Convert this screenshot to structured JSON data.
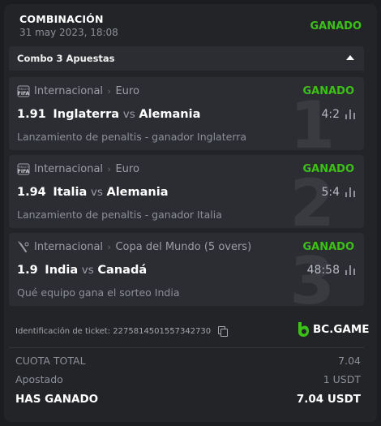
{
  "header": {
    "title": "COMBINACIÓN",
    "date": "31 may 2023, 18:08",
    "status": "GANADO"
  },
  "combo": {
    "label": "Combo 3 Apuestas"
  },
  "legs": [
    {
      "index": "1",
      "sport_icon": "efootball-penalty-icon",
      "category": "Internacional",
      "league": "Euro",
      "status": "GANADO",
      "odds": "1.91",
      "home": "Inglaterra",
      "vs": "vs",
      "away": "Alemania",
      "score": "4:2",
      "market": "Lanzamiento de penaltis - ganador Inglaterra"
    },
    {
      "index": "2",
      "sport_icon": "efootball-penalty-icon",
      "category": "Internacional",
      "league": "Euro",
      "status": "GANADO",
      "odds": "1.94",
      "home": "Italia",
      "vs": "vs",
      "away": "Alemania",
      "score": "5:4",
      "market": "Lanzamiento de penaltis - ganador Italia"
    },
    {
      "index": "3",
      "sport_icon": "cricket-icon",
      "category": "Internacional",
      "league": "Copa del Mundo (5 overs)",
      "status": "GANADO",
      "odds": "1.9",
      "home": "India",
      "vs": "vs",
      "away": "Canadá",
      "score": "48:58",
      "market": "Qué equipo gana el sorteo India"
    }
  ],
  "ticket": {
    "label": "Identificación de ticket:",
    "id": "2275814501557342730"
  },
  "brand": {
    "name": "BC.GAME"
  },
  "summary": {
    "total_odds_label": "CUOTA TOTAL",
    "total_odds_value": "7.04",
    "staked_label": "Apostado",
    "staked_value": "1 USDT",
    "won_label": "HAS GANADO",
    "won_value": "7.04 USDT"
  },
  "colors": {
    "accent_green": "#3bc117",
    "background": "#1c1d21",
    "card": "#232428",
    "panel": "#2c2d32"
  }
}
